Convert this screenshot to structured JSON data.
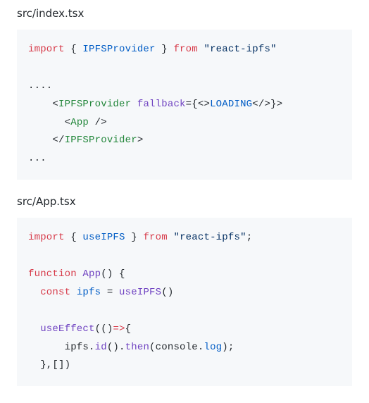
{
  "block1": {
    "filename": "src/index.tsx",
    "line1": {
      "kw_import": "import",
      "brace_open": " { ",
      "ident": "IPFSProvider",
      "brace_close": " } ",
      "kw_from": "from",
      "sp": " ",
      "str": "\"react-ipfs\""
    },
    "ellipsis_top": "....",
    "line2": {
      "indent": "    ",
      "lt": "<",
      "tag": "IPFSProvider",
      "sp": " ",
      "attr": "fallback",
      "eq_open": "={",
      "inner_lt": "<",
      "inner_gt": ">",
      "text": "LOADING",
      "inner_lt2": "<",
      "inner_slash": "/",
      "inner_gt2": ">",
      "close": "}>"
    },
    "line3": {
      "indent": "      ",
      "lt": "<",
      "tag": "App",
      "sp_slash_gt": " />"
    },
    "line4": {
      "indent": "    ",
      "lt_slash": "</",
      "tag": "IPFSProvider",
      "gt": ">"
    },
    "ellipsis_bot": "..."
  },
  "block2": {
    "filename": "src/App.tsx",
    "line1": {
      "kw_import": "import",
      "brace_open": " { ",
      "ident": "useIPFS",
      "brace_close": " } ",
      "kw_from": "from",
      "sp": " ",
      "str": "\"react-ipfs\"",
      "semi": ";"
    },
    "line2": {
      "kw_fn": "function",
      "sp": " ",
      "name": "App",
      "parens_brace": "() {"
    },
    "line3": {
      "indent": "  ",
      "kw_const": "const",
      "sp": " ",
      "var": "ipfs",
      "eq": " = ",
      "call": "useIPFS",
      "parens": "()"
    },
    "line4": {
      "indent": "  ",
      "call": "useEffect",
      "open": "(()",
      "arrow": "=>",
      "brace": "{"
    },
    "line5": {
      "indent": "      ",
      "obj": "ipfs",
      "dot1": ".",
      "m1": "id",
      "paren1": "().",
      "m2": "then",
      "open2": "(",
      "cons": "console",
      "dot2": ".",
      "log": "log",
      "close": ");"
    },
    "line6": {
      "indent": "  ",
      "close": "},[])"
    }
  }
}
